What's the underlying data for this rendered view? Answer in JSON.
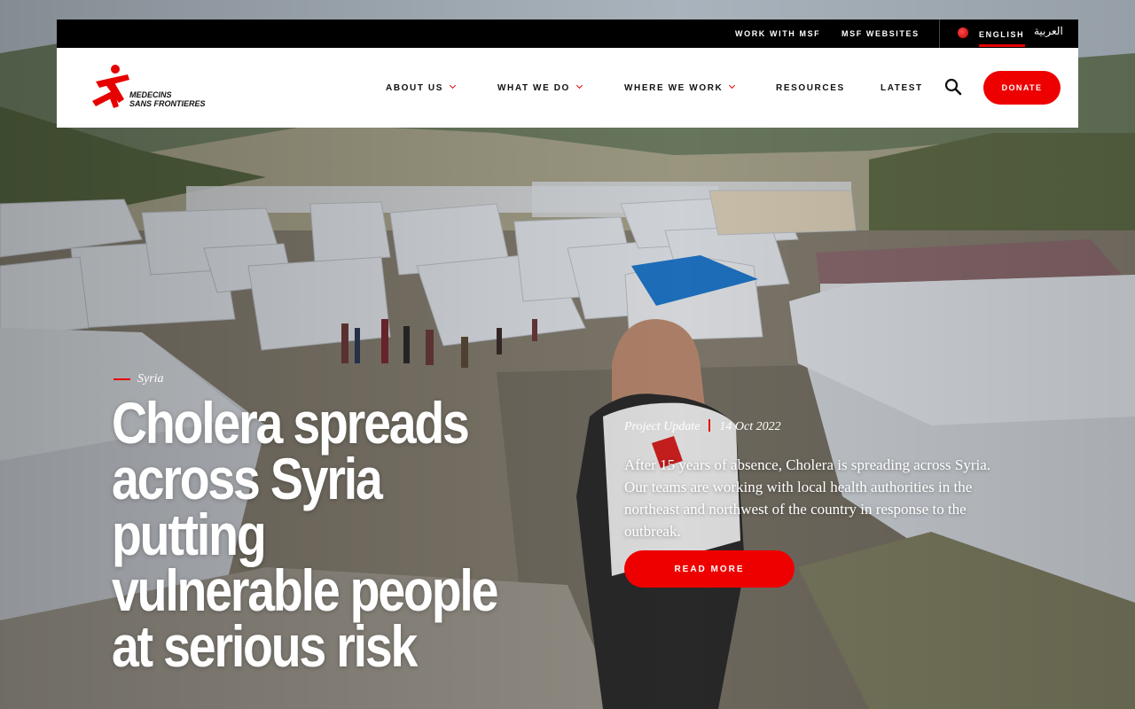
{
  "topbar": {
    "links": [
      "WORK WITH MSF",
      "MSF WEBSITES"
    ],
    "language_active": "ENGLISH",
    "language_alt": "العربية"
  },
  "brand": {
    "logo_text": "MEDECINS\nSANS FRONTIERES",
    "accent_color": "#ee0000"
  },
  "nav": {
    "items": [
      {
        "label": "ABOUT US",
        "has_dropdown": true
      },
      {
        "label": "WHAT WE DO",
        "has_dropdown": true
      },
      {
        "label": "WHERE WE WORK",
        "has_dropdown": true
      },
      {
        "label": "RESOURCES",
        "has_dropdown": false
      },
      {
        "label": "LATEST",
        "has_dropdown": false
      }
    ],
    "search_icon": "search-icon",
    "donate_label": "DONATE"
  },
  "hero": {
    "kicker": "Syria",
    "headline": "Cholera spreads across Syria putting vulnerable people at serious risk",
    "meta": {
      "type": "Project Update",
      "date": "14 Oct 2022"
    },
    "summary": "After 15 years of absence, Cholera is spreading across Syria. Our teams are working with local health authorities in the northeast and northwest of the country in response to the outbreak.",
    "cta_label": "READ MORE"
  }
}
